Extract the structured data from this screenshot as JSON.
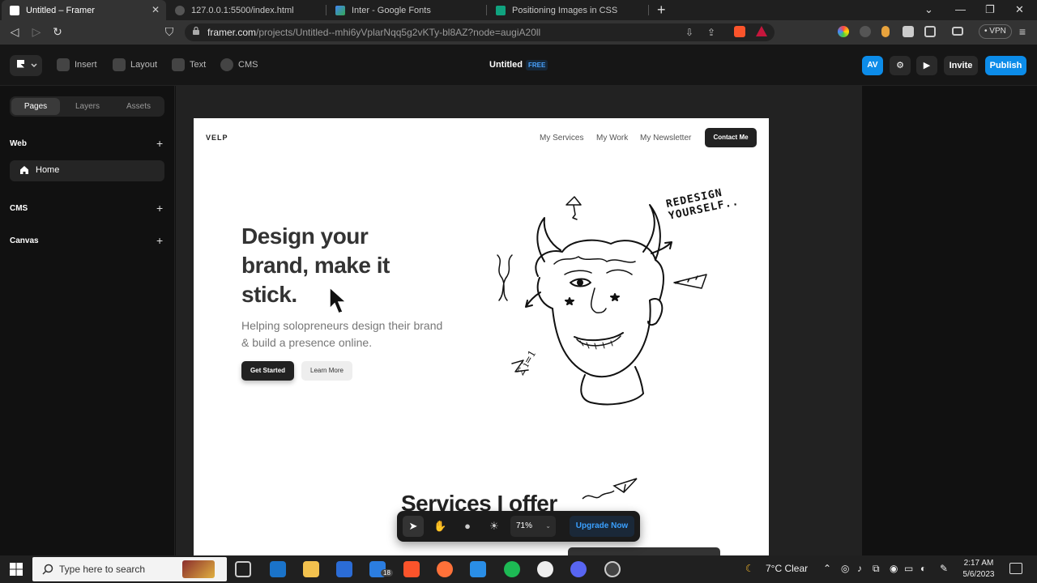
{
  "browser": {
    "tabs": [
      {
        "title": "Untitled – Framer",
        "active": true
      },
      {
        "title": "127.0.0.1:5500/index.html",
        "active": false
      },
      {
        "title": "Inter - Google Fonts",
        "active": false
      },
      {
        "title": "Positioning Images in CSS",
        "active": false
      }
    ],
    "new_tab_label": "+",
    "url_host": "framer.com",
    "url_path": "/projects/Untitled--mhi6yVplarNqq5g2vKTy-bl8AZ?node=augiA20ll",
    "vpn_label": "• VPN",
    "icons": [
      "back-icon",
      "forward-icon",
      "reload-icon",
      "bookmark-icon",
      "lock-icon",
      "download-icon",
      "share-icon",
      "brave-shields-icon",
      "extensions-icon",
      "sidebar-icon",
      "wallet-icon",
      "menu-icon"
    ]
  },
  "framer": {
    "toolbar": {
      "insert": "Insert",
      "layout": "Layout",
      "text": "Text",
      "cms": "CMS",
      "project_title": "Untitled",
      "plan_badge": "FREE",
      "avatar": "AV",
      "invite": "Invite",
      "publish": "Publish"
    },
    "left_panel": {
      "tabs": [
        "Pages",
        "Layers",
        "Assets"
      ],
      "active_tab": "Pages",
      "sections": {
        "web": "Web",
        "cms": "CMS",
        "canvas": "Canvas"
      },
      "pages": [
        {
          "label": "Home"
        }
      ]
    },
    "bottom_toolbar": {
      "zoom": "71%",
      "upgrade": "Upgrade Now",
      "tools": [
        "select-tool-icon",
        "hand-tool-icon",
        "comment-icon",
        "theme-icon"
      ]
    }
  },
  "site": {
    "brand": "VELP",
    "nav": [
      "My Services",
      "My Work",
      "My Newsletter"
    ],
    "contact": "Contact Me",
    "hero": {
      "line1": "Design your",
      "line2": "brand, make it",
      "line3": "stick.",
      "subtitle": "Helping solopreneurs design their brand & build a presence online.",
      "primary_cta": "Get Started",
      "secondary_cta": "Learn More"
    },
    "illustration_text": {
      "line1": "REDESIGN",
      "line2": "YOURSELF..",
      "formula": "Σ i=1"
    },
    "services_heading": "Services I offer"
  },
  "taskbar": {
    "search_placeholder": "Type here to search",
    "weather": "7°C  Clear",
    "time": "2:17 AM",
    "date": "5/6/2023",
    "badge_count": "18",
    "apps": [
      "task-view-icon",
      "remote-icon",
      "file-explorer-icon",
      "store-icon",
      "mail-icon",
      "brave-icon",
      "firefox-icon",
      "vscode-icon",
      "spotify-icon",
      "github-icon",
      "discord-icon",
      "obs-icon"
    ]
  }
}
